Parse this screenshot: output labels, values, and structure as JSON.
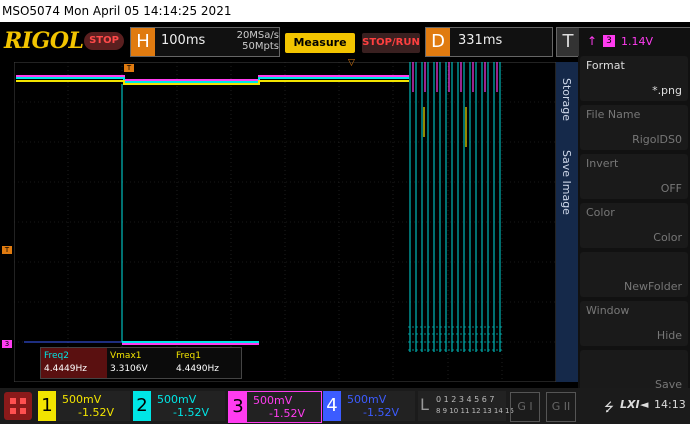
{
  "titlebar": {
    "text": "MSO5074  Mon April 05 14:14:25 2021"
  },
  "toolbar": {
    "logo": "RIGOL",
    "stop_label": "STOP",
    "horizontal": {
      "letter": "H",
      "timebase": "100ms",
      "sample_rate": "20MSa/s",
      "memory_depth": "50Mpts"
    },
    "measure_label": "Measure",
    "stoprun_label": "STOP/RUN",
    "delay": {
      "letter": "D",
      "value": "331ms"
    },
    "trigger": {
      "letter": "T",
      "source": "3",
      "level": "1.14V"
    }
  },
  "grid": {
    "trigger_marker": "T",
    "ch3_marker": "3",
    "ch1_marker": "T"
  },
  "side_panel": {
    "tabs": [
      "Storage",
      "Save Image"
    ],
    "items": [
      {
        "label": "Format",
        "value": "*.png",
        "enabled": true
      },
      {
        "label": "File Name",
        "value": "RigolDS0",
        "enabled": false
      },
      {
        "label": "Invert",
        "value": "OFF",
        "enabled": false
      },
      {
        "label": "Color",
        "value": "Color",
        "enabled": false
      },
      {
        "label": "",
        "value": "NewFolder",
        "enabled": false
      },
      {
        "label": "Window",
        "value": "Hide",
        "enabled": false
      },
      {
        "label": "",
        "value": "Save",
        "enabled": false
      }
    ]
  },
  "measurements": [
    {
      "name": "Freq2",
      "value": "4.4449Hz",
      "color": "#00e5e5",
      "highlight": "#5a1010"
    },
    {
      "name": "Vmax1",
      "value": "3.3106V",
      "color": "#f2e400",
      "highlight": ""
    },
    {
      "name": "Freq1",
      "value": "4.4490Hz",
      "color": "#f2e400",
      "highlight": ""
    }
  ],
  "channels": [
    {
      "num": "1",
      "scale": "500mV",
      "offset": "-1.52V",
      "color": "#f2e400"
    },
    {
      "num": "2",
      "scale": "500mV",
      "offset": "-1.52V",
      "color": "#00e5e5"
    },
    {
      "num": "3",
      "scale": "500mV",
      "offset": "-1.52V",
      "color": "#ff3cf0"
    },
    {
      "num": "4",
      "scale": "500mV",
      "offset": "-1.52V",
      "color": "#3c5cff"
    }
  ],
  "logic": {
    "letter": "L",
    "row1": "0 1 2 3 4 5 6 7",
    "row2": "8 9 10 11 12 13 14 15"
  },
  "gen_buttons": [
    "G I",
    "G II"
  ],
  "status": {
    "lxi": "LXI",
    "time": "14:13"
  },
  "colors": {
    "accent": "#e07b10",
    "logo": "#f2c400",
    "panel_tab": "#15294a"
  }
}
